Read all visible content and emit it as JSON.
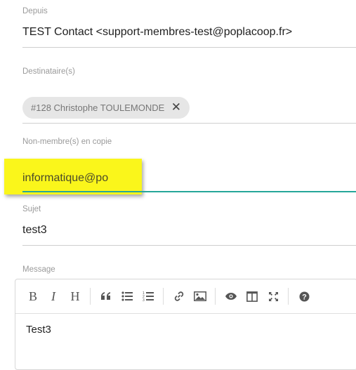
{
  "from": {
    "label": "Depuis",
    "value": "TEST Contact <support-membres-test@poplacoop.fr>"
  },
  "recipients": {
    "label": "Destinataire(s)",
    "chip": "#128 Christophe TOULEMONDE",
    "remove_glyph": "✕"
  },
  "cc": {
    "label": "Non-membre(s) en copie",
    "value": "informatique@po"
  },
  "subject": {
    "label": "Sujet",
    "value": "test3"
  },
  "message": {
    "label": "Message",
    "toolbar": {
      "bold": "B",
      "italic": "I",
      "heading": "H",
      "icons": [
        "quote-icon",
        "unordered-list-icon",
        "ordered-list-icon",
        "link-icon",
        "image-icon",
        "preview-icon",
        "side-by-side-icon",
        "fullscreen-icon",
        "help-icon"
      ]
    },
    "content": "Test3"
  },
  "colors": {
    "highlight": "#faf61b",
    "focus_line": "#26a69a",
    "chip_bg": "#e6e6e6"
  }
}
